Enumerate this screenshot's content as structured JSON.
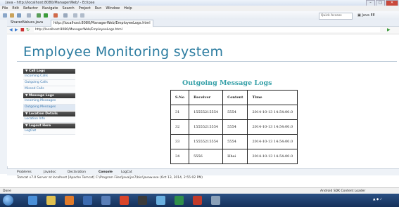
{
  "window": {
    "title": "Java - http://localhost:8080/ManagerWeb/ - Eclipse"
  },
  "menubar": [
    "File",
    "Edit",
    "Refactor",
    "Navigate",
    "Search",
    "Project",
    "Run",
    "Window",
    "Help"
  ],
  "toolbar": {
    "quick_access_placeholder": "Quick Access",
    "perspective": "Java EE"
  },
  "editor_tabs": [
    "SharedValues.java",
    "http://localhost:8080/ManagerWeb/EmployeeLogs.html"
  ],
  "address": {
    "url": "http://localhost:8080/ManagerWeb/EmployeeLogs.html"
  },
  "app": {
    "title": "Employee Monitoring system"
  },
  "sidebar": {
    "sections": [
      {
        "header": "▼ Call Logs",
        "items": [
          "Incoming Calls",
          "Outgoing Calls",
          "Missed Calls"
        ]
      },
      {
        "header": "▼ Message Logs",
        "items": [
          "Incoming Messages",
          "Outgoing Messages"
        ]
      },
      {
        "header": "▼ Location Details",
        "items": [
          "Location Info"
        ]
      },
      {
        "header": "▼ Logout Here",
        "items": [
          "LogOut"
        ]
      }
    ]
  },
  "content": {
    "heading": "Outgoing Message Logs",
    "columns": [
      "S.No",
      "Receiver",
      "Content",
      "Time"
    ],
    "rows": [
      [
        "31",
        "15555215554",
        "5554",
        "2014-10-13 14:54:00.0"
      ],
      [
        "32",
        "15555215554",
        "5554",
        "2014-10-13 14:54:00.0"
      ],
      [
        "33",
        "15555215554",
        "5554",
        "2014-10-13 14:54:00.0"
      ],
      [
        "34",
        "5556",
        "Hhai",
        "2014-10-13 14:54:00.0"
      ]
    ]
  },
  "console": {
    "tabs": [
      "Problems",
      "Javadoc",
      "Declaration",
      "Console",
      "LogCat"
    ],
    "line": "Tomcat v7.0 Server at localhost [Apache Tomcat] C:\\Program Files\\Java\\jre7\\bin\\javaw.exe (Oct 13, 2014, 2:55:02 PM)"
  },
  "status": {
    "left": "Done",
    "right": "Android SDK Content Loader"
  },
  "colors": {
    "accent": "#2c7ca0",
    "heading": "#36a0a8",
    "link": "#3a78b0",
    "taskbar": "#1e3f6e"
  }
}
